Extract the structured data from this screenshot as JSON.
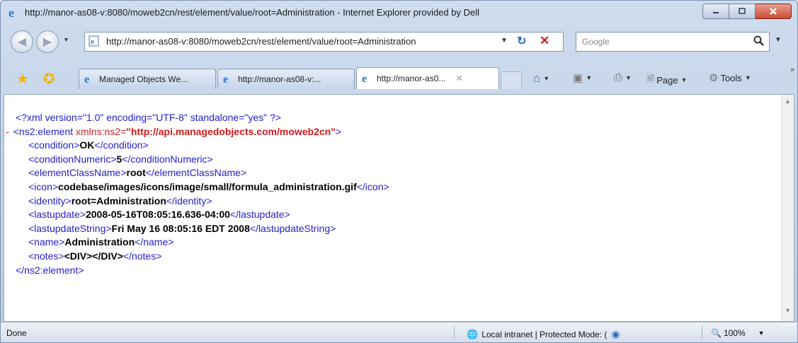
{
  "window": {
    "title": "http://manor-as08-v:8080/moweb2cn/rest/element/value/root=Administration - Internet Explorer provided by Dell"
  },
  "address_bar": {
    "url": "http://manor-as08-v:8080/moweb2cn/rest/element/value/root=Administration"
  },
  "search": {
    "placeholder": "Google"
  },
  "tabs": [
    {
      "label": "Managed Objects We..."
    },
    {
      "label": "http://manor-as08-v:..."
    },
    {
      "label": "http://manor-as0...",
      "active": true
    }
  ],
  "toolbar": {
    "page_label": "Page",
    "tools_label": "Tools"
  },
  "xml": {
    "declaration": "<?xml version=\"1.0\" encoding=\"UTF-8\" standalone=\"yes\" ?>",
    "collapse_marker": "-",
    "root_open_tag": "<ns2:element",
    "root_attr": "xmlns:ns2=",
    "root_attr_value": "\"http://api.managedobjects.com/moweb2cn\"",
    "root_open_end": ">",
    "root_close_tag": "</ns2:element>",
    "fields": [
      {
        "open": "<condition>",
        "value": "OK",
        "close": "</condition>"
      },
      {
        "open": "<conditionNumeric>",
        "value": "5",
        "close": "</conditionNumeric>"
      },
      {
        "open": "<elementClassName>",
        "value": "root",
        "close": "</elementClassName>"
      },
      {
        "open": "<icon>",
        "value": "codebase/images/icons/image/small/formula_administration.gif",
        "close": "</icon>"
      },
      {
        "open": "<identity>",
        "value": "root=Administration",
        "close": "</identity>"
      },
      {
        "open": "<lastupdate>",
        "value": "2008-05-16T08:05:16.636-04:00",
        "close": "</lastupdate>"
      },
      {
        "open": "<lastupdateString>",
        "value": "Fri May 16 08:05:16 EDT 2008",
        "close": "</lastupdateString>"
      },
      {
        "open": "<name>",
        "value": "Administration",
        "close": "</name>"
      },
      {
        "open": "<notes>",
        "value": "<DIV></DIV>",
        "close": "</notes>"
      }
    ]
  },
  "status_bar": {
    "status_text": "Done",
    "zone_text": "Local intranet | Protected Mode: (",
    "zoom_text": "100%"
  },
  "colors": {
    "xml_tag": "#2222cc",
    "xml_attr_value": "#d11b1b",
    "window_frame": "#b9cbe4"
  },
  "icons": [
    "ie-logo-icon",
    "minimize-icon",
    "maximize-icon",
    "close-icon",
    "back-icon",
    "forward-icon",
    "page-icon",
    "refresh-icon",
    "stop-icon",
    "search-icon",
    "favorites-star-icon",
    "add-favorites-icon",
    "home-icon",
    "feeds-icon",
    "print-icon",
    "page-menu-icon",
    "tools-gear-icon",
    "globe-icon",
    "protected-mode-icon",
    "zoom-icon"
  ]
}
